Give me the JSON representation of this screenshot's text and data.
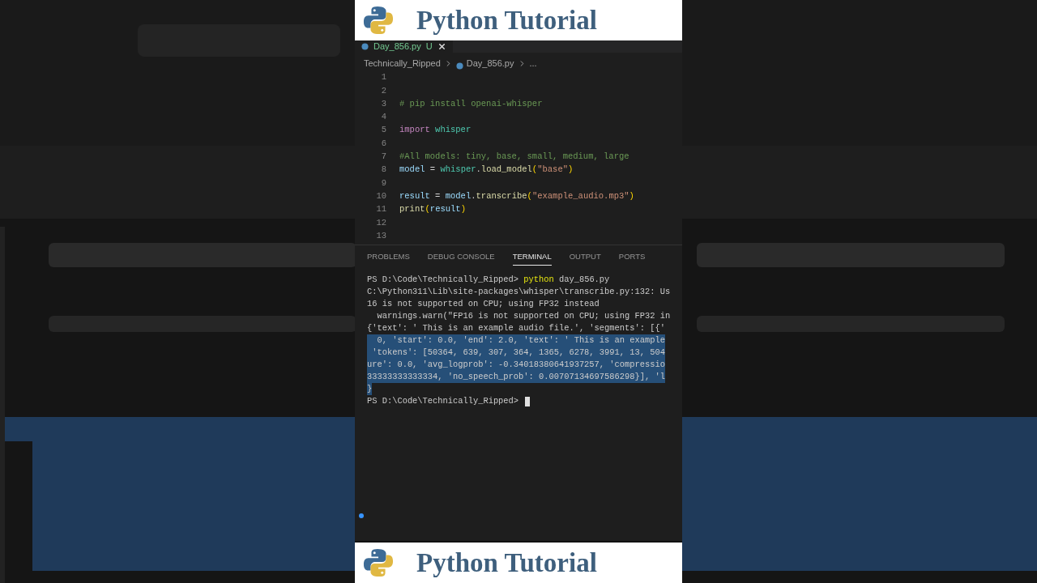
{
  "top_banner": {
    "title": "Python Tutorial"
  },
  "editor": {
    "tab": {
      "label": "Day_856.py",
      "status": "U",
      "selected": true
    },
    "breadcrumb": [
      "Technically_Ripped",
      "Day_856.py",
      "..."
    ],
    "lines": [
      {
        "number": "1"
      },
      {
        "number": "2"
      },
      {
        "number": "3",
        "tokens": [
          {
            "text": "# pip install openai-whisper",
            "kind": "comment"
          }
        ]
      },
      {
        "number": "4"
      },
      {
        "number": "5",
        "tokens": [
          {
            "text": "import ",
            "kind": "keyword"
          },
          {
            "text": "whisper",
            "kind": "module"
          }
        ]
      },
      {
        "number": "6"
      },
      {
        "number": "7",
        "tokens": [
          {
            "text": "#All models: tiny, base, small, medium, large",
            "kind": "comment"
          }
        ]
      },
      {
        "number": "8",
        "tokens": [
          {
            "text": "model",
            "kind": "var"
          },
          {
            "text": " = ",
            "kind": "plain"
          },
          {
            "text": "whisper",
            "kind": "module"
          },
          {
            "text": ".",
            "kind": "plain"
          },
          {
            "text": "load_model",
            "kind": "func"
          },
          {
            "text": "(",
            "kind": "paren"
          },
          {
            "text": "\"base\"",
            "kind": "str"
          },
          {
            "text": ")",
            "kind": "paren"
          }
        ]
      },
      {
        "number": "9"
      },
      {
        "number": "10",
        "tokens": [
          {
            "text": "result",
            "kind": "var"
          },
          {
            "text": " = ",
            "kind": "plain"
          },
          {
            "text": "model",
            "kind": "var"
          },
          {
            "text": ".",
            "kind": "plain"
          },
          {
            "text": "transcribe",
            "kind": "func"
          },
          {
            "text": "(",
            "kind": "paren"
          },
          {
            "text": "\"example_audio.mp3\"",
            "kind": "str"
          },
          {
            "text": ")",
            "kind": "paren"
          }
        ]
      },
      {
        "number": "11",
        "tokens": [
          {
            "text": "print",
            "kind": "func"
          },
          {
            "text": "(",
            "kind": "paren"
          },
          {
            "text": "result",
            "kind": "var"
          },
          {
            "text": ")",
            "kind": "paren"
          }
        ]
      },
      {
        "number": "12"
      },
      {
        "number": "13"
      }
    ]
  },
  "panel": {
    "tabs": [
      {
        "label": "PROBLEMS",
        "selected": false
      },
      {
        "label": "DEBUG CONSOLE",
        "selected": false
      },
      {
        "label": "TERMINAL",
        "selected": true
      },
      {
        "label": "OUTPUT",
        "selected": false
      },
      {
        "label": "PORTS",
        "selected": false
      }
    ],
    "terminal": [
      {
        "parts": [
          {
            "text": "PS D:\\Code\\Technically_Ripped> ",
            "kind": "plain"
          },
          {
            "text": "python",
            "kind": "command"
          },
          {
            "text": " day_856.py",
            "kind": "plain"
          }
        ],
        "selected": false
      },
      {
        "parts": [
          {
            "text": "C:\\Python311\\Lib\\site-packages\\whisper\\transcribe.py:132: Us",
            "kind": "plain"
          }
        ],
        "selected": false
      },
      {
        "parts": [
          {
            "text": "16 is not supported on CPU; using FP32 instead",
            "kind": "plain"
          }
        ],
        "selected": false
      },
      {
        "parts": [
          {
            "text": "  warnings.warn(\"FP16 is not supported on CPU; using FP32 in",
            "kind": "plain"
          }
        ],
        "selected": false
      },
      {
        "parts": [
          {
            "text": "{'text': ' This is an example audio file.', 'segments': [{'",
            "kind": "plain"
          }
        ],
        "selected": false
      },
      {
        "parts": [
          {
            "text": "  0, 'start': 0.0, 'end': 2.0, 'text': ' This is an example",
            "kind": "plain"
          }
        ],
        "selected": true
      },
      {
        "parts": [
          {
            "text": " 'tokens': [50364, 639, 307, 364, 1365, 6278, 3991, 13, 504",
            "kind": "plain"
          }
        ],
        "selected": true
      },
      {
        "parts": [
          {
            "text": "ure': 0.0, 'avg_logprob': -0.34018380641937257, 'compressio",
            "kind": "plain"
          }
        ],
        "selected": true
      },
      {
        "parts": [
          {
            "text": "33333333333334, 'no_speech_prob': 0.00707134697586298}], 'l",
            "kind": "plain"
          }
        ],
        "selected": true
      },
      {
        "parts": [
          {
            "text": "}",
            "kind": "plain"
          }
        ],
        "selected": true
      },
      {
        "parts": [
          {
            "text": "PS D:\\Code\\Technically_Ripped> ",
            "kind": "plain"
          }
        ],
        "selected": false,
        "cursor": true
      }
    ]
  },
  "bottom_banner": {
    "title": "Python Tutorial"
  }
}
